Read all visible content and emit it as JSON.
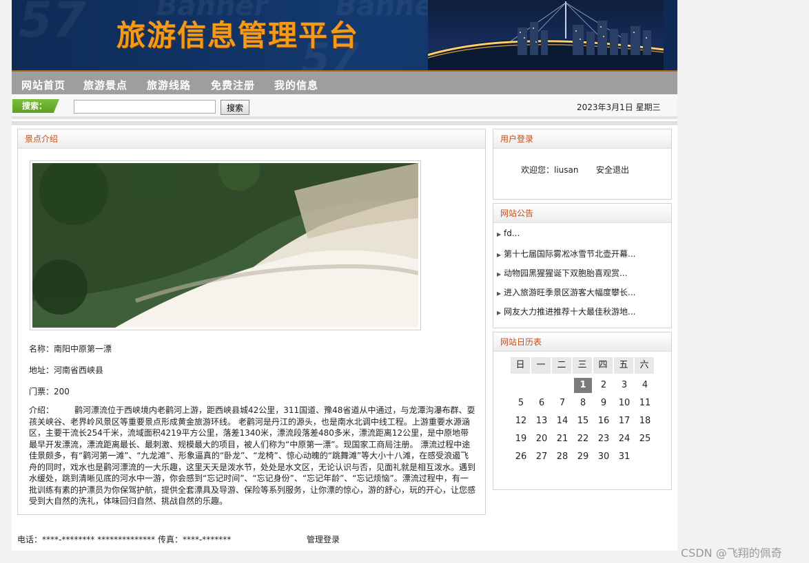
{
  "banner": {
    "title": "旅游信息管理平台"
  },
  "nav": [
    "网站首页",
    "旅游景点",
    "旅游线路",
    "免费注册",
    "我的信息"
  ],
  "search": {
    "label": "搜索：",
    "value": "",
    "placeholder": "",
    "button": "搜索"
  },
  "date": "2023年3月1日 星期三",
  "main": {
    "title": "景点介绍",
    "name": "名称：南阳中原第一漂",
    "address": "地址：河南省西峡县",
    "ticket": "门票：200",
    "intro": "介绍：　　　鹳河漂流位于西峡境内老鹳河上游，距西峡县城42公里，311国道、豫48省道从中通过，与龙潭沟瀑布群、耍孩关峡谷、老界岭风景区等重要景点形成黄金旅游环线。 老鹳河是丹江的源头，也是南水北调中线工程。上游重要水源涵区，主要干流长254千米，流域面积4219平方公里，落差1340米，漂流段落差480多米，漂流距离12公里，是中原地带最早开发漂流，漂流距离最长、最刺激、规模最大的项目，被人们称为“中原第一漂”。现国家工商局注册。 漂流过程中途佳景颇多，有“鹳河第一滩”、“九龙滩”、形象逼真的“卧龙”、“龙椅”、惊心动魄的“跳舞滩”等大小十八滩，在感受浪遏飞舟的同时，戏水也是鹳河漂流的一大乐趣，这里天天是泼水节，处处是水文区，无论认识与否，见面礼就是相互泼水。遇到水缓处，跳到清晰见底的河水中一游，你会感到“忘记时间”、“忘记身份”、“忘记年龄”、“忘记烦恼”。漂流过程中，有一批训练有素的护漂员为你保驾护航，提供全套漂具及导游、保险等系列服务，让你漂的惊心，游的舒心，玩的开心，让您感受到大自然的洗礼，体味回归自然、挑战自然的乐趣。"
  },
  "login": {
    "title": "用户登录",
    "welcome": "欢迎您：liusan",
    "logout": "安全退出"
  },
  "notices": {
    "title": "网站公告",
    "items": [
      "fd...",
      "第十七届国际雾凇冰雪节北壶开幕...",
      "动物园黑猩猩诞下双胞胎喜观赏...",
      "进入旅游旺季景区游客大幅度攀长...",
      "网友大力推进推荐十大最佳秋游地..."
    ]
  },
  "calendar": {
    "title": "网站日历表",
    "weekdays": [
      "日",
      "一",
      "二",
      "三",
      "四",
      "五",
      "六"
    ],
    "today": "1",
    "weeks": [
      [
        "",
        "",
        "",
        "1",
        "2",
        "3",
        "4"
      ],
      [
        "5",
        "6",
        "7",
        "8",
        "9",
        "10",
        "11"
      ],
      [
        "12",
        "13",
        "14",
        "15",
        "16",
        "17",
        "18"
      ],
      [
        "19",
        "20",
        "21",
        "22",
        "23",
        "24",
        "25"
      ],
      [
        "26",
        "27",
        "28",
        "29",
        "30",
        "31",
        ""
      ]
    ]
  },
  "footer": {
    "contact": "电话：****-********  **************  传真：****-*******",
    "admin": "管理登录"
  },
  "watermark": "CSDN @飞翔的佩奇"
}
